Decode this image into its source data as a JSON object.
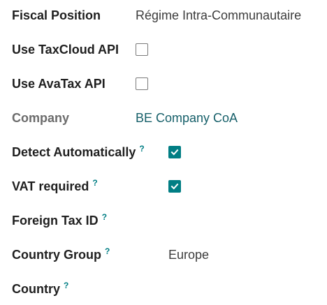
{
  "fields": {
    "fiscal_position": {
      "label": "Fiscal Position",
      "value": "Régime Intra-Communautaire"
    },
    "use_taxcloud": {
      "label": "Use TaxCloud API",
      "checked": false
    },
    "use_avatax": {
      "label": "Use AvaTax API",
      "checked": false
    },
    "company": {
      "label": "Company",
      "value": "BE Company CoA"
    },
    "detect_automatically": {
      "label": "Detect Automatically",
      "help": "?",
      "checked": true
    },
    "vat_required": {
      "label": "VAT required",
      "help": "?",
      "checked": true
    },
    "foreign_tax_id": {
      "label": "Foreign Tax ID",
      "help": "?",
      "value": ""
    },
    "country_group": {
      "label": "Country Group",
      "help": "?",
      "value": "Europe"
    },
    "country": {
      "label": "Country",
      "help": "?",
      "value": ""
    }
  },
  "colors": {
    "accent": "#017e84",
    "link": "#17606a",
    "label": "#1f1f1f",
    "muted": "#6c6c6c"
  },
  "icons": {
    "check": "check-icon",
    "help": "question-mark"
  }
}
